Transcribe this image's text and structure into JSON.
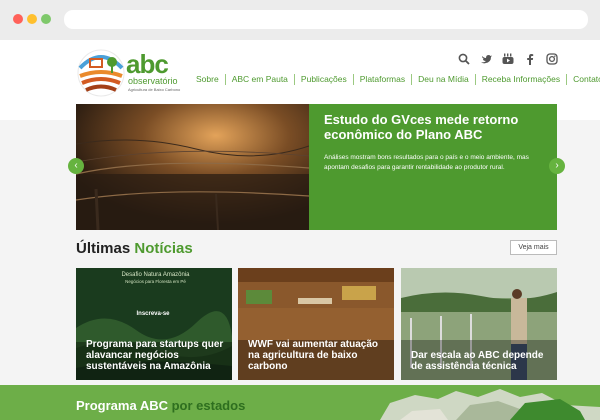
{
  "logo": {
    "word": "abc",
    "subtitle": "observatório",
    "tagline": "Agricultura de Baixo Carbono"
  },
  "social": {
    "icons": [
      "search-icon",
      "twitter-icon",
      "youtube-icon",
      "facebook-icon",
      "instagram-icon"
    ]
  },
  "nav": {
    "items": [
      "Sobre",
      "ABC em Pauta",
      "Publicações",
      "Plataformas",
      "Deu na Mídia",
      "Receba Informações",
      "Contato"
    ]
  },
  "hero": {
    "title": "Estudo do GVces mede retorno econômico do Plano ABC",
    "text": "Análises mostram bons resultados para o país e o meio ambiente, mas apontam desafios para garantir rentabilidade ao produtor rural.",
    "prev_label": "‹",
    "next_label": "›"
  },
  "news": {
    "title_part1": "Últimas",
    "title_part2": "Notícias",
    "see_more": "Veja mais",
    "cards": [
      {
        "caption": "Programa para startups quer alavancar negócios sustentáveis na Amazônia",
        "banner": "Desafio Natura Amazônia",
        "banner_sub": "Negócios para Floresta em Pé",
        "cta": "Inscreva-se"
      },
      {
        "caption": "WWF vai aumentar atuação na agricultura de baixo carbono"
      },
      {
        "caption": "Dar escala ao ABC depende de assistência técnica"
      }
    ]
  },
  "states": {
    "title_part1": "Programa ABC",
    "title_part2": "por estados"
  },
  "colors": {
    "brand_green": "#4e9a2f",
    "brand_orange": "#ea8a2c",
    "banner_green": "#6dae48"
  }
}
